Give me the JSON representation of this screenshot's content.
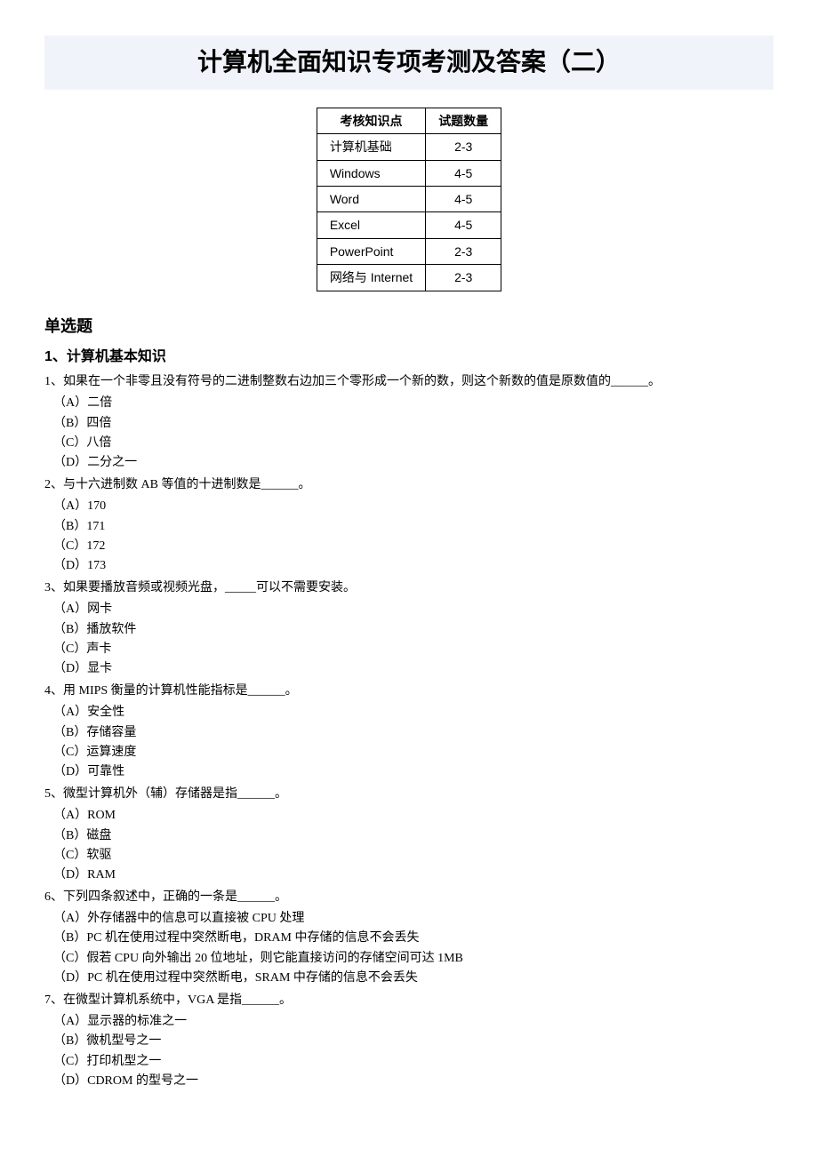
{
  "title": "计算机全面知识专项考测及答案（二）",
  "summary_table": {
    "headers": [
      "考核知识点",
      "试题数量"
    ],
    "rows": [
      [
        "计算机基础",
        "2-3"
      ],
      [
        "Windows",
        "4-5"
      ],
      [
        "Word",
        "4-5"
      ],
      [
        "Excel",
        "4-5"
      ],
      [
        "PowerPoint",
        "2-3"
      ],
      [
        "网络与 Internet",
        "2-3"
      ]
    ]
  },
  "section_heading": "单选题",
  "subsection_heading": "1、计算机基本知识",
  "questions": [
    {
      "stem": "1、如果在一个非零且没有符号的二进制整数右边加三个零形成一个新的数，则这个新数的值是原数值的______。",
      "options": [
        "（A）二倍",
        "（B）四倍",
        "（C）八倍",
        "（D）二分之一"
      ]
    },
    {
      "stem": "2、与十六进制数 AB 等值的十进制数是______。",
      "options": [
        "（A）170",
        "（B）171",
        "（C）172",
        "（D）173"
      ]
    },
    {
      "stem": "3、如果要播放音频或视频光盘，_____可以不需要安装。",
      "options": [
        "（A）网卡",
        "（B）播放软件",
        "（C）声卡",
        "（D）显卡"
      ]
    },
    {
      "stem": "4、用 MIPS 衡量的计算机性能指标是______。",
      "options": [
        "（A）安全性",
        "（B）存储容量",
        "（C）运算速度",
        "（D）可靠性"
      ]
    },
    {
      "stem": "5、微型计算机外（辅）存储器是指______。",
      "options": [
        "（A）ROM",
        "（B）磁盘",
        "（C）软驱",
        "（D）RAM"
      ]
    },
    {
      "stem": "6、下列四条叙述中，正确的一条是______。",
      "options": [
        "（A）外存储器中的信息可以直接被 CPU 处理",
        "（B）PC 机在使用过程中突然断电，DRAM 中存储的信息不会丢失",
        "（C）假若 CPU 向外输出 20 位地址，则它能直接访问的存储空间可达 1MB",
        "（D）PC 机在使用过程中突然断电，SRAM 中存储的信息不会丢失"
      ]
    },
    {
      "stem": "7、在微型计算机系统中，VGA 是指______。",
      "options": [
        "（A）显示器的标准之一",
        "（B）微机型号之一",
        "（C）打印机型之一",
        "（D）CDROM 的型号之一"
      ]
    }
  ]
}
